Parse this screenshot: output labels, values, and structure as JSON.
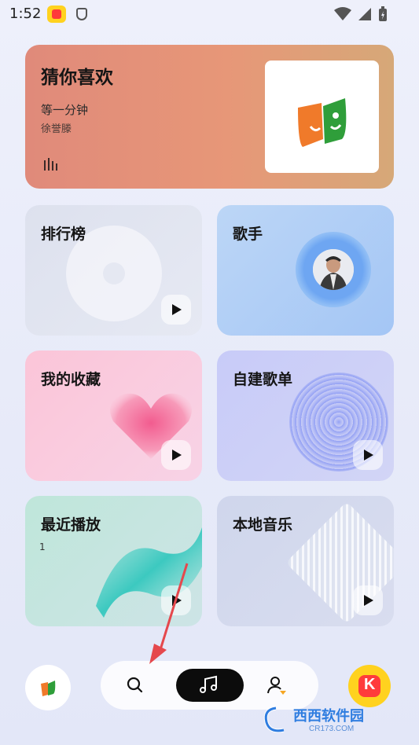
{
  "status_bar": {
    "time": "1:52"
  },
  "hero": {
    "title": "猜你喜欢",
    "song": "等一分钟",
    "artist": "徐誉滕"
  },
  "cards": {
    "rank": {
      "title": "排行榜"
    },
    "singer": {
      "title": "歌手"
    },
    "favorites": {
      "title": "我的收藏"
    },
    "playlist": {
      "title": "自建歌单"
    },
    "recent": {
      "title": "最近播放",
      "count": "1"
    },
    "local": {
      "title": "本地音乐"
    }
  },
  "watermark": {
    "text": "西西软件园",
    "url": "CR173.COM"
  },
  "colors": {
    "accent": "#0c0c0c",
    "brand_yellow": "#ffd21f",
    "brand_red": "#ff3b3b",
    "annotation_arrow": "#e5484d"
  },
  "icons": [
    "search-icon",
    "music-note-icon",
    "profile-icon",
    "play-icon",
    "equalizer-icon",
    "wifi-icon",
    "signal-icon",
    "battery-icon",
    "shield-icon"
  ]
}
